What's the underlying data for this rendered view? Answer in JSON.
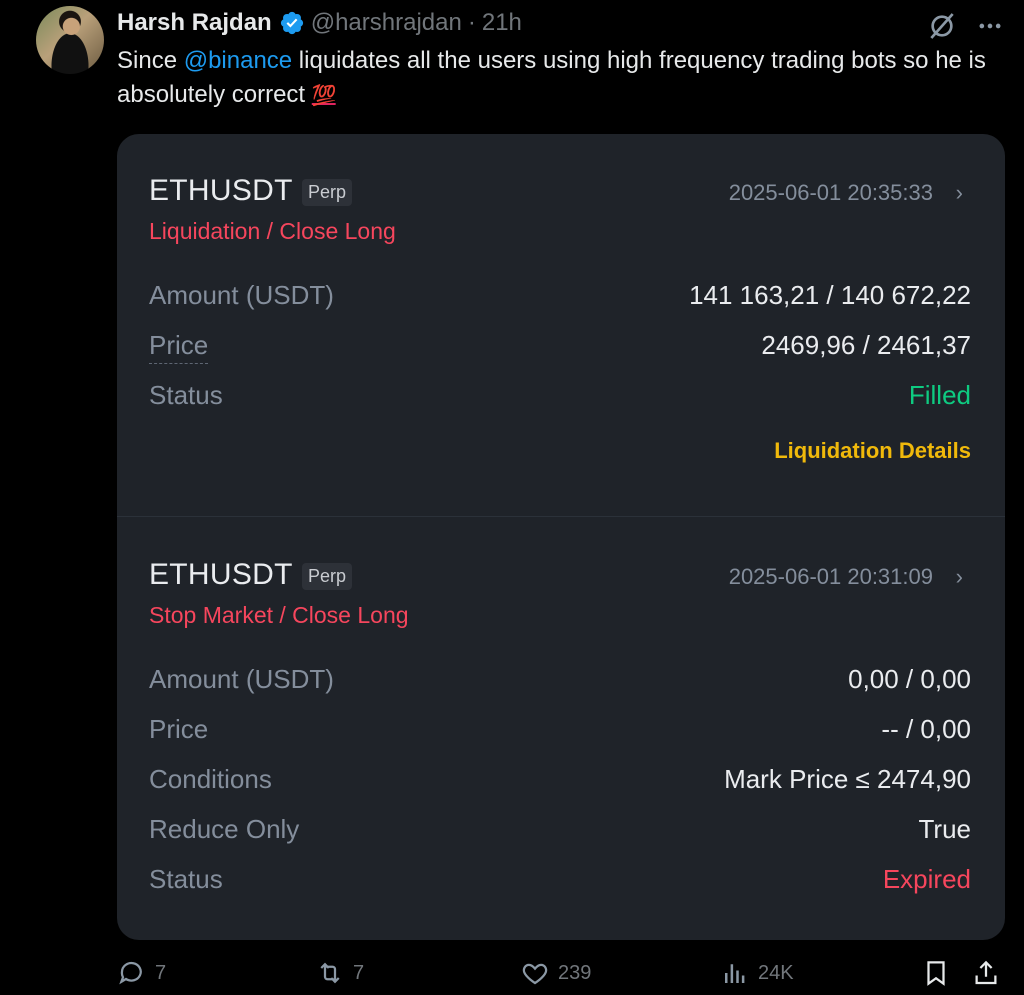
{
  "tweet": {
    "author_name": "Harsh Rajdan",
    "author_handle": "@harshrajdan",
    "separator": "·",
    "time": "21h",
    "text_part1": "Since ",
    "mention": "@binance",
    "text_part2": " liquidates all the users using high frequency trading bots so he is absolutely correct ",
    "emoji": "💯"
  },
  "orders": [
    {
      "symbol": "ETHUSDT",
      "tag": "Perp",
      "timestamp": "2025-06-01 20:35:33",
      "type": "Liquidation / Close Long",
      "rows": [
        {
          "label": "Amount (USDT)",
          "value": "141 163,21 / 140 672,22"
        },
        {
          "label": "Price",
          "value": "2469,96 / 2461,37"
        },
        {
          "label": "Status",
          "value": "Filled"
        }
      ],
      "link": "Liquidation Details"
    },
    {
      "symbol": "ETHUSDT",
      "tag": "Perp",
      "timestamp": "2025-06-01 20:31:09",
      "type": "Stop Market / Close Long",
      "rows": [
        {
          "label": "Amount (USDT)",
          "value": "0,00 / 0,00"
        },
        {
          "label": "Price",
          "value": "-- / 0,00"
        },
        {
          "label": "Conditions",
          "value": "Mark Price ≤ 2474,90"
        },
        {
          "label": "Reduce Only",
          "value": "True"
        },
        {
          "label": "Status",
          "value": "Expired"
        }
      ]
    }
  ],
  "actions": {
    "replies": "7",
    "reposts": "7",
    "likes": "239",
    "views": "24K"
  },
  "colors": {
    "background": "#000000",
    "card": "#1f2329",
    "mention": "#1d9bf0",
    "sell_red": "#f6465d",
    "buy_green": "#0ecb81",
    "binance_yellow": "#f0b90b"
  },
  "icons": [
    "verified-badge-icon",
    "grok-icon",
    "more-icon",
    "chevron-right-icon",
    "reply-icon",
    "repost-icon",
    "like-icon",
    "views-icon",
    "bookmark-icon",
    "share-icon"
  ]
}
